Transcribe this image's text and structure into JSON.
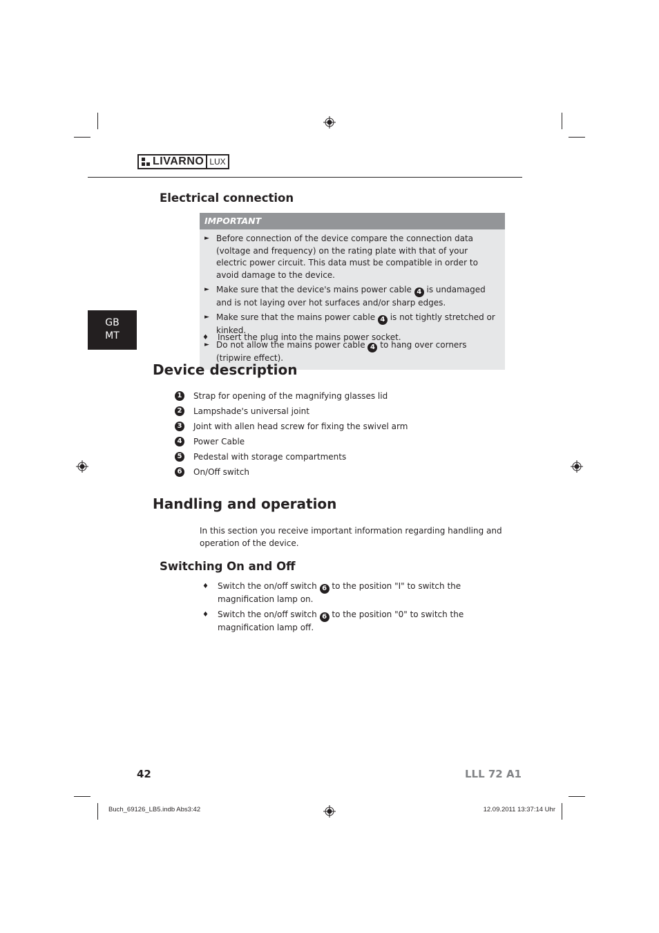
{
  "header": {
    "logo_brand": "LIVARNO",
    "logo_sub": "LUX"
  },
  "language_tab": {
    "line1": "GB",
    "line2": "MT"
  },
  "electrical_connection": {
    "title": "Electrical connection",
    "important_box": {
      "heading": "IMPORTANT",
      "items": [
        {
          "before": "Before connection of the device compare the connection data (voltage and frequency) on the rating plate with that of your electric power circuit. This data must be compatible in order to avoid damage to the device.",
          "ref": null,
          "after": ""
        },
        {
          "before": "Make sure that the device's mains power cable ",
          "ref": "4",
          "after": " is undamaged and is not laying over hot surfaces and/or sharp edges."
        },
        {
          "before": "Make sure that the mains power cable ",
          "ref": "4",
          "after": " is not tightly stretched or kinked."
        },
        {
          "before": "Do not allow the mains power cable ",
          "ref": "4",
          "after": " to hang over corners (tripwire effect)."
        }
      ]
    },
    "step": "Insert the plug into the mains power socket."
  },
  "device_description": {
    "title": "Device description",
    "parts": [
      {
        "num": "1",
        "label": "Strap for opening of the magnifying glasses lid"
      },
      {
        "num": "2",
        "label": "Lampshade's universal joint"
      },
      {
        "num": "3",
        "label": "Joint with allen head screw for fixing the swivel arm"
      },
      {
        "num": "4",
        "label": "Power Cable"
      },
      {
        "num": "5",
        "label": "Pedestal with storage compartments"
      },
      {
        "num": "6",
        "label": "On/Off switch"
      }
    ]
  },
  "handling": {
    "title": "Handling and operation",
    "intro": "In this section you receive important information regarding handling and operation of the device.",
    "switching": {
      "title": "Switching On and Off",
      "steps": [
        {
          "before": "Switch the on/off switch ",
          "ref": "6",
          "after": " to the position \"I\" to switch the magnification lamp on."
        },
        {
          "before": "Switch the on/off switch ",
          "ref": "6",
          "after": " to the position \"0\" to switch the magnification lamp off."
        }
      ]
    }
  },
  "footer": {
    "page_number": "42",
    "model": "LLL 72 A1",
    "slug_left": "Buch_69126_LB5.indb   Abs3:42",
    "slug_right": "12.09.2011   13:37:14 Uhr"
  },
  "icons": {
    "important_bullet": "►",
    "step_bullet": "♦"
  }
}
